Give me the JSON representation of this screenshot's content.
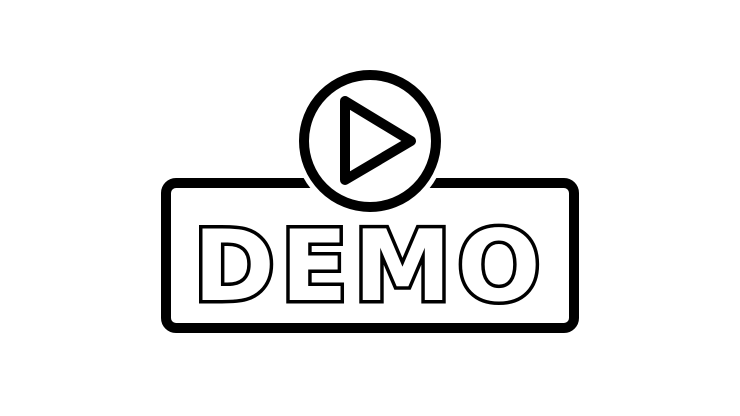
{
  "badge": {
    "label": "DEMO",
    "stroke_color": "#000000",
    "background_color": "#ffffff",
    "icon": "play-circle-icon"
  }
}
